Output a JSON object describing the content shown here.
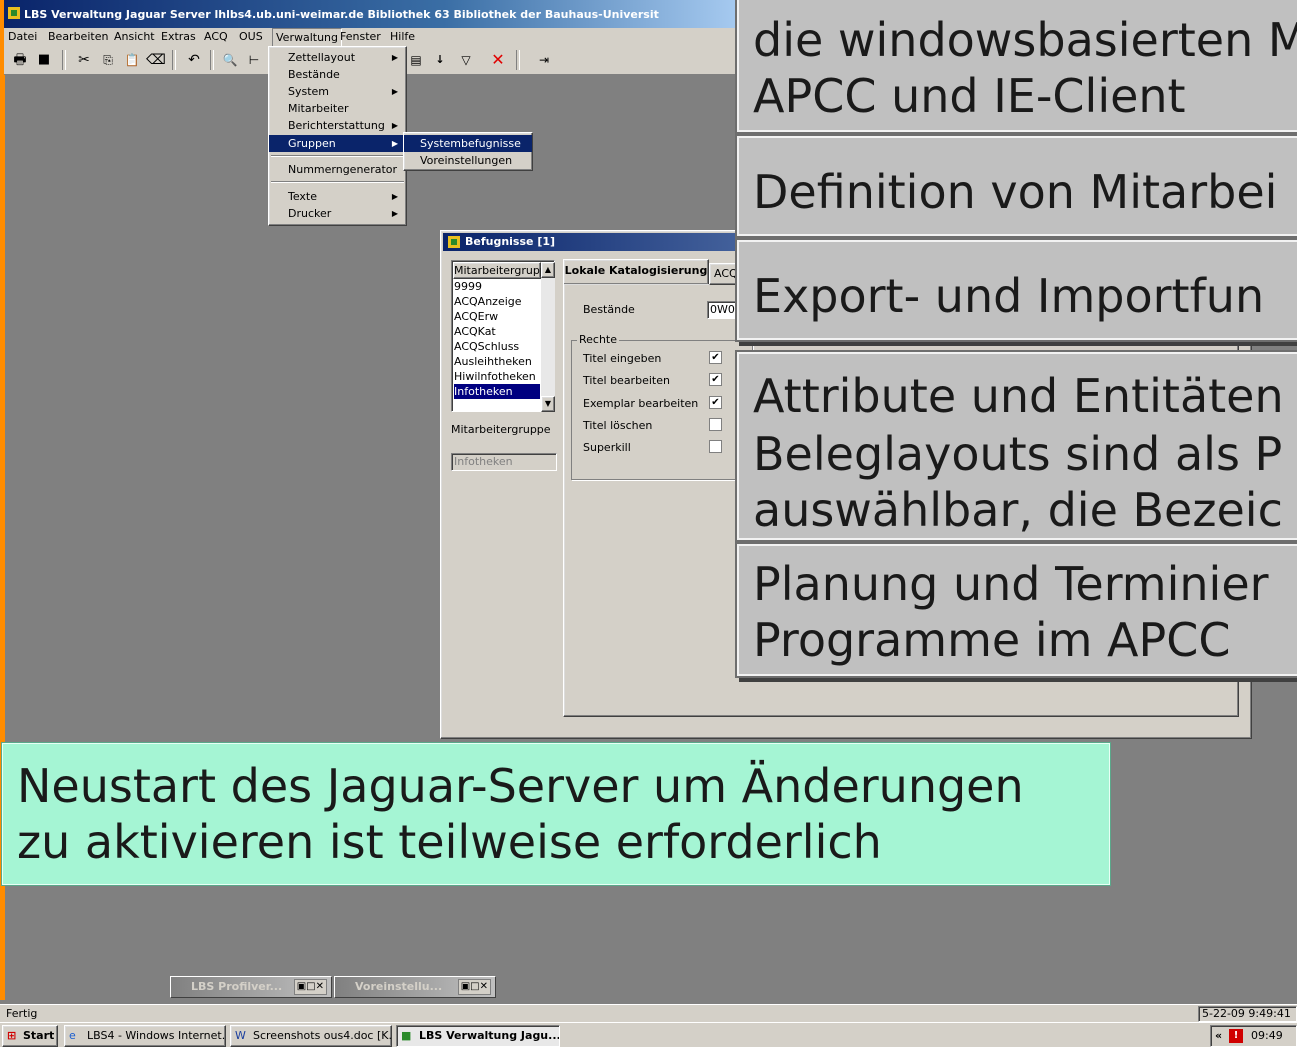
{
  "window": {
    "title": "LBS Verwaltung Jaguar Server lhlbs4.ub.uni-weimar.de  Bibliothek 63 Bibliothek der Bauhaus-Universit"
  },
  "menubar": [
    "Datei",
    "Bearbeiten",
    "Ansicht",
    "Extras",
    "ACQ",
    "OUS",
    "Verwaltung",
    "Fenster",
    "Hilfe"
  ],
  "verwaltung_menu": [
    {
      "label": "Zettellayout",
      "submenu": true
    },
    {
      "label": "Bestände",
      "submenu": false
    },
    {
      "label": "System",
      "submenu": true
    },
    {
      "label": "Mitarbeiter",
      "submenu": false
    },
    {
      "label": "Berichterstattung",
      "submenu": true
    },
    {
      "label": "Gruppen",
      "submenu": true,
      "selected": true
    },
    {
      "label": "Nummerngenerator",
      "submenu": false
    },
    {
      "label": "Texte",
      "submenu": true
    },
    {
      "label": "Drucker",
      "submenu": true
    }
  ],
  "gruppen_submenu": [
    {
      "label": "Systembefugnisse",
      "selected": true
    },
    {
      "label": "Voreinstellungen",
      "selected": false
    }
  ],
  "dialog": {
    "title": "Befugnisse [1]",
    "list_header": "Mitarbeitergrupp",
    "groups": [
      "9999",
      "ACQAnzeige",
      "ACQErw",
      "ACQKat",
      "ACQSchluss",
      "Ausleihtheken",
      "Hiwilnfotheken",
      "Infotheken"
    ],
    "selected_group": "Infotheken",
    "group_label": "Mitarbeitergruppe",
    "group_value": "Infotheken",
    "tabs": [
      "Lokale Katalogisierung",
      "ACQ"
    ],
    "bestaende_label": "Bestände",
    "bestaende_value": "0W0",
    "rechte_label": "Rechte",
    "rights": [
      {
        "label": "Titel eingeben",
        "checked": true
      },
      {
        "label": "Titel bearbeiten",
        "checked": true
      },
      {
        "label": "Exemplar bearbeiten",
        "checked": true
      },
      {
        "label": "Titel löschen",
        "checked": false
      },
      {
        "label": "Superkill",
        "checked": false
      }
    ]
  },
  "callouts": [
    {
      "lines": [
        "die windowsbasierten M",
        "APCC und IE-Client"
      ]
    },
    {
      "lines": [
        "Definition von Mitarbei"
      ]
    },
    {
      "lines": [
        "Export- und Importfun"
      ]
    },
    {
      "lines": [
        "Attribute und Entitäten",
        "Beleglayouts sind als P",
        "auswählbar, die Bezeic"
      ]
    },
    {
      "lines": [
        "Planung und Terminier",
        "Programme im APCC"
      ]
    }
  ],
  "green_callout": {
    "lines": [
      "Neustart des Jaguar-Server um Änderungen",
      "zu aktivieren ist teilweise erforderlich"
    ]
  },
  "minimized_windows": [
    "LBS Profilver...",
    "Voreinstellu..."
  ],
  "statusbar": {
    "left": "Fertig",
    "right": "5-22-09 9:49:41"
  },
  "taskbar": {
    "start": "Start",
    "tasks": [
      "LBS4 - Windows Internet...",
      "Screenshots ous4.doc [K...",
      "LBS Verwaltung Jagu..."
    ],
    "clock": "09:49"
  },
  "colors": {
    "titlebar": "#0a246a",
    "accent_orange": "#ff8c00",
    "green_callout": "#a5f5d4",
    "selection": "#0a246a"
  }
}
